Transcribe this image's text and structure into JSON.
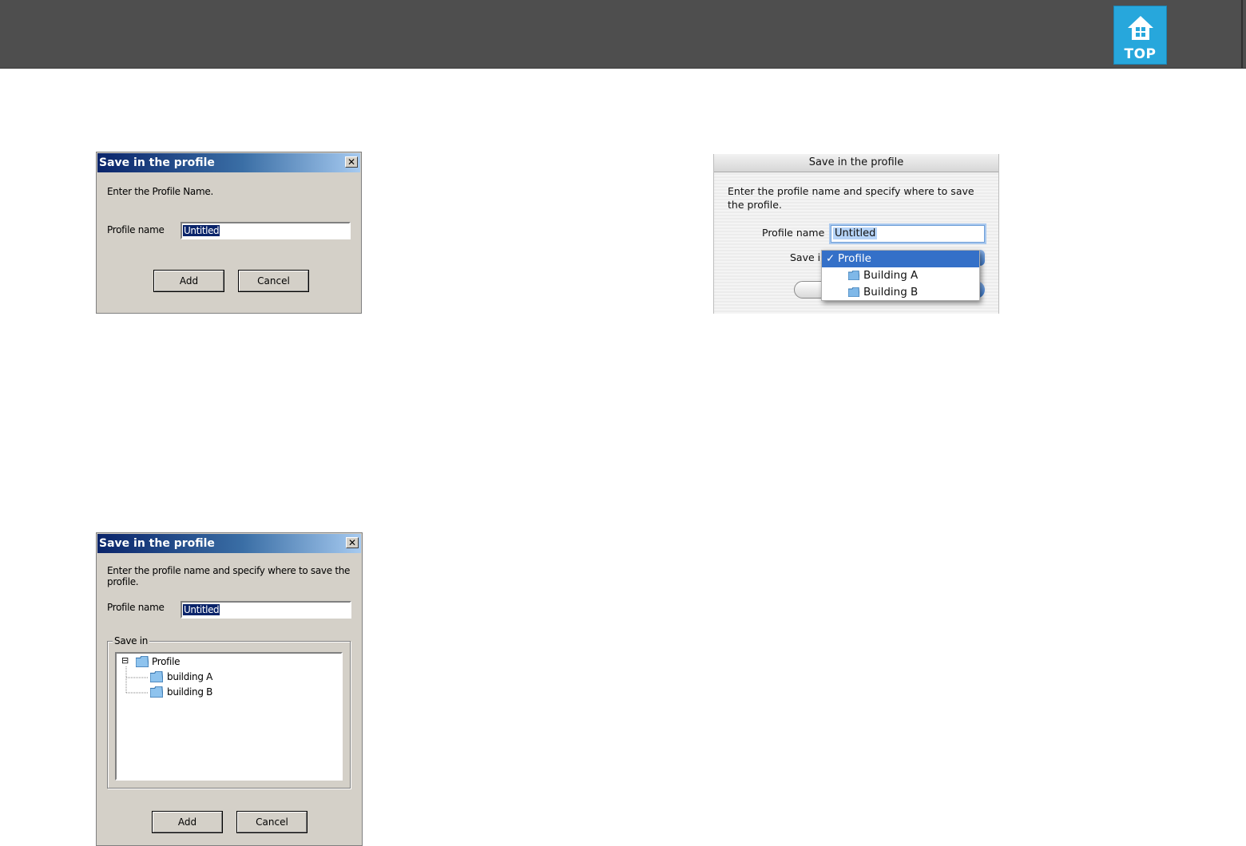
{
  "banner": {
    "top_label": "TOP"
  },
  "dialog_simple": {
    "title": "Save in the profile",
    "close_glyph": "✕",
    "prompt": "Enter the Profile Name.",
    "profile_name_label": "Profile name",
    "profile_name_value": "Untitled",
    "add_label": "Add",
    "cancel_label": "Cancel"
  },
  "dialog_mac": {
    "title": "Save in the profile",
    "prompt_line1": "Enter the profile name and specify where to save",
    "prompt_line2": "the profile.",
    "profile_name_label": "Profile name",
    "profile_name_value": "Untitled",
    "save_in_label": "Save in",
    "menu_items": [
      {
        "label": "Profile",
        "checked": true
      },
      {
        "label": "Building A",
        "checked": false
      },
      {
        "label": "Building B",
        "checked": false
      }
    ],
    "check_glyph": "✓"
  },
  "dialog_tree": {
    "title": "Save in the profile",
    "close_glyph": "✕",
    "prompt": "Enter the profile name and specify where to save the profile.",
    "profile_name_label": "Profile name",
    "profile_name_value": "Untitled",
    "save_in_label": "Save in",
    "tree": {
      "root": "Profile",
      "children": [
        "building A",
        "building B"
      ],
      "expand_glyph": "⊟"
    },
    "add_label": "Add",
    "cancel_label": "Cancel"
  },
  "colors": {
    "banner": "#4e4e4e",
    "top_button": "#27a7dc",
    "win_face": "#d4d0c8",
    "win_title_start": "#0a246a",
    "mac_selection": "#3470c8"
  }
}
